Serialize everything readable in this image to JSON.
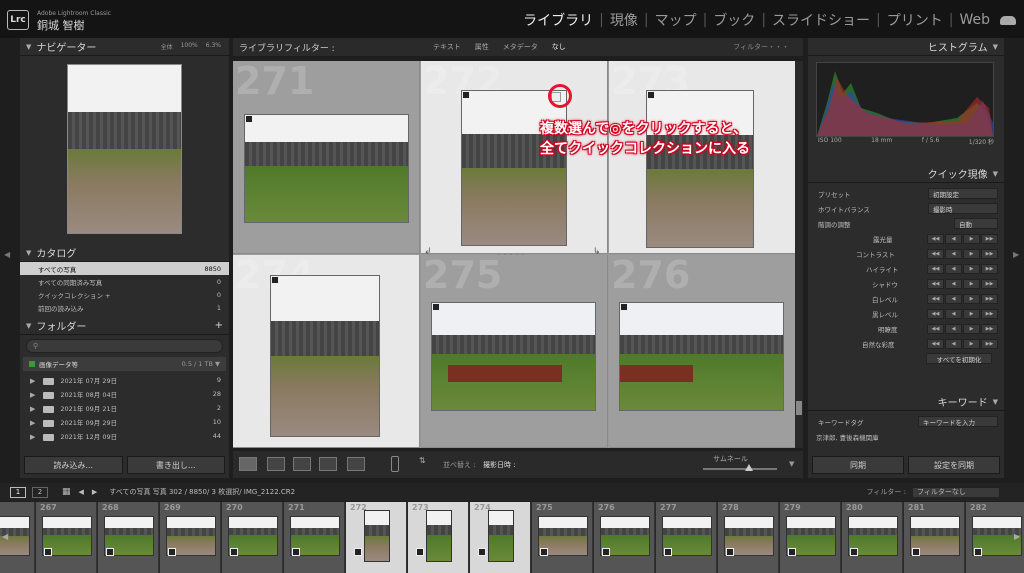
{
  "app": {
    "product": "Adobe Lightroom Classic",
    "user": "銅城 智樹",
    "logo": "Lrc"
  },
  "modules": [
    "ライブラリ",
    "現像",
    "マップ",
    "ブック",
    "スライドショー",
    "プリント",
    "Web"
  ],
  "navigator": {
    "title": "ナビゲーター",
    "zoom_opts": [
      "全体",
      "100%",
      "6.3%"
    ]
  },
  "catalog": {
    "title": "カタログ",
    "items": [
      {
        "label": "すべての写真",
        "count": "8850"
      },
      {
        "label": "すべての同期済み写真",
        "count": "0"
      },
      {
        "label": "クイックコレクション +",
        "count": "0"
      },
      {
        "label": "前回の読み込み",
        "count": "1"
      }
    ]
  },
  "folders": {
    "title": "フォルダー",
    "volume": {
      "name": "画像データ等",
      "size": "0.5 / 1 TB"
    },
    "items": [
      {
        "label": "2021年 07月 29日",
        "count": "9"
      },
      {
        "label": "2021年 08月 04日",
        "count": "28"
      },
      {
        "label": "2021年 09月 21日",
        "count": "2"
      },
      {
        "label": "2021年 09月 29日",
        "count": "10"
      },
      {
        "label": "2021年 12月 09日",
        "count": "44"
      }
    ]
  },
  "left_buttons": {
    "import": "読み込み...",
    "export": "書き出し..."
  },
  "filter_bar": {
    "title": "ライブラリフィルター :",
    "tabs": [
      "テキスト",
      "属性",
      "メタデータ",
      "なし"
    ],
    "right": "フィルター・・・"
  },
  "grid": {
    "cells": [
      {
        "num": "271"
      },
      {
        "num": "272"
      },
      {
        "num": "273"
      },
      {
        "num": "274"
      },
      {
        "num": "275"
      },
      {
        "num": "276"
      }
    ]
  },
  "toolbar": {
    "sort_label": "並べ替え :",
    "sort_value": "撮影日時 :",
    "thumb_label": "サムネール"
  },
  "histogram": {
    "title": "ヒストグラム",
    "iso": "ISO 100",
    "focal": "18 mm",
    "aperture": "f / 5.6",
    "shutter": "1/320 秒"
  },
  "quick_develop": {
    "title": "クイック現像",
    "preset_label": "プリセット",
    "preset_value": "初期設定",
    "wb_label": "ホワイトバランス",
    "wb_value": "撮影時",
    "tone_label": "階調の調整",
    "tone_value": "自動",
    "sliders": [
      "露光量",
      "コントラスト",
      "ハイライト",
      "シャドウ",
      "白レベル",
      "黒レベル",
      "明瞭度",
      "自然な彩度"
    ],
    "reset": "すべてを初期化"
  },
  "keywords": {
    "title": "キーワード",
    "tag_label": "キーワードタグ",
    "tag_value": "キーワードを入力",
    "value": "京津郎, 豊後森機関庫"
  },
  "sync": {
    "sync": "同期",
    "sync_settings": "設定を同期"
  },
  "filmstrip": {
    "screens": [
      "1",
      "2"
    ],
    "path": "すべての写真  写真 302 / 8850/ 3 枚選択/ IMG_2122.CR2",
    "filter_label": "フィルター :",
    "filter_value": "フィルターなし",
    "numbers": [
      "267",
      "268",
      "269",
      "270",
      "271",
      "272",
      "273",
      "274",
      "275",
      "276",
      "277",
      "278",
      "279",
      "280",
      "281",
      "282"
    ]
  },
  "annotation": {
    "line1": "複数選んで◎をクリックすると、",
    "line2": "全てクイックコレクションに入る"
  },
  "colors": {
    "accent": "#e8142d",
    "panel": "#2c2c2c"
  }
}
